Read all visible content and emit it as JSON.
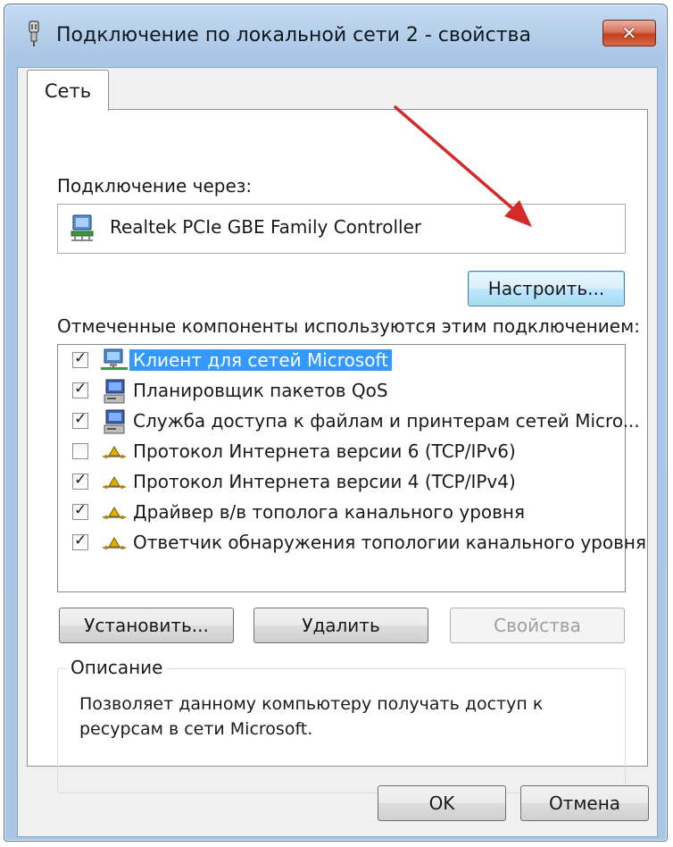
{
  "window": {
    "title": "Подключение по локальной сети 2 - свойства",
    "close_label": "✕"
  },
  "tabs": [
    {
      "label": "Сеть",
      "active": true
    }
  ],
  "connection": {
    "label": "Подключение через:",
    "adapter_name": "Realtek PCIe GBE Family Controller",
    "configure_button": "Настроить..."
  },
  "components": {
    "label": "Отмеченные компоненты используются этим подключением:",
    "items": [
      {
        "label": "Клиент для сетей Microsoft",
        "checked": true,
        "icon": "network-client-icon",
        "selected": true
      },
      {
        "label": "Планировщик пакетов QoS",
        "checked": true,
        "icon": "service-computer-icon",
        "selected": false
      },
      {
        "label": "Служба доступа к файлам и принтерам сетей Micro...",
        "checked": true,
        "icon": "service-computer-icon",
        "selected": false
      },
      {
        "label": "Протокол Интернета версии 6 (TCP/IPv6)",
        "checked": false,
        "icon": "protocol-icon",
        "selected": false
      },
      {
        "label": "Протокол Интернета версии 4 (TCP/IPv4)",
        "checked": true,
        "icon": "protocol-icon",
        "selected": false
      },
      {
        "label": "Драйвер в/в тополога канального уровня",
        "checked": true,
        "icon": "protocol-icon",
        "selected": false
      },
      {
        "label": "Ответчик обнаружения топологии канального уровня",
        "checked": true,
        "icon": "protocol-icon",
        "selected": false
      }
    ]
  },
  "actions": {
    "install": "Установить...",
    "remove": "Удалить",
    "properties": "Свойства"
  },
  "description": {
    "title": "Описание",
    "text": "Позволяет данному компьютеру получать доступ к ресурсам в сети Microsoft."
  },
  "footer": {
    "ok": "OK",
    "cancel": "Отмена"
  },
  "colors": {
    "annotation_arrow": "#d42a2a",
    "selection": "#3399ff"
  }
}
